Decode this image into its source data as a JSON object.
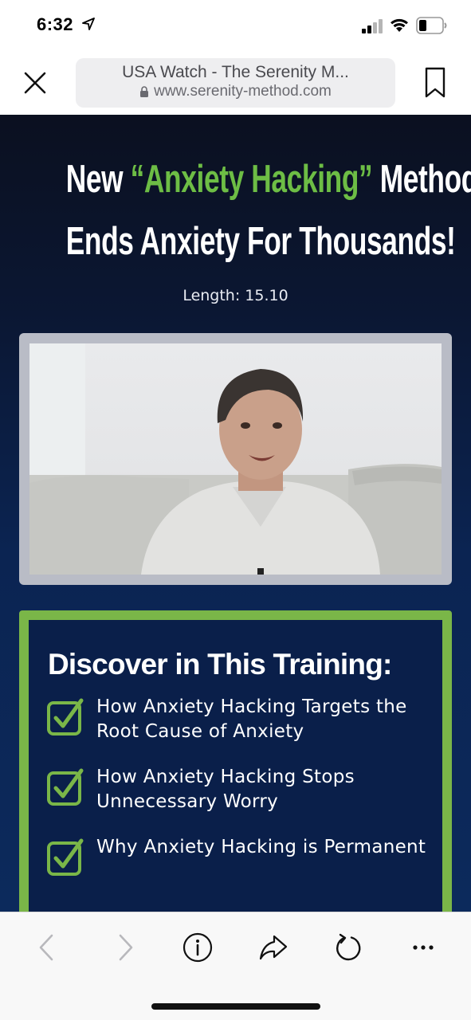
{
  "status_bar": {
    "time": "6:32",
    "icons": [
      "location-arrow-icon",
      "signal-icon",
      "wifi-icon",
      "battery-icon"
    ]
  },
  "browser": {
    "page_title": "USA Watch - The Serenity M...",
    "url": "www.serenity-method.com",
    "icons": [
      "close-icon",
      "lock-icon",
      "bookmark-icon"
    ]
  },
  "page": {
    "headline_line1_prefix": "New ",
    "headline_highlight": "“Anxiety Hacking”",
    "headline_line1_suffix": " Method",
    "headline_line2": "Ends Anxiety For Thousands!",
    "length_label": "Length: 15.10",
    "training": {
      "title": "Discover in This Training:",
      "items": [
        "How Anxiety Hacking Targets the Root Cause of Anxiety",
        "How Anxiety Hacking Stops Unnecessary Worry",
        "Why Anxiety Hacking is Permanent"
      ]
    }
  },
  "toolbar": {
    "buttons": [
      "back-arrow-icon",
      "forward-arrow-icon",
      "info-icon",
      "share-icon",
      "reload-icon",
      "more-icon"
    ]
  },
  "colors": {
    "highlight_green": "#6dbd45",
    "box_border_green": "#7ab648",
    "page_background": "#0b2452"
  }
}
